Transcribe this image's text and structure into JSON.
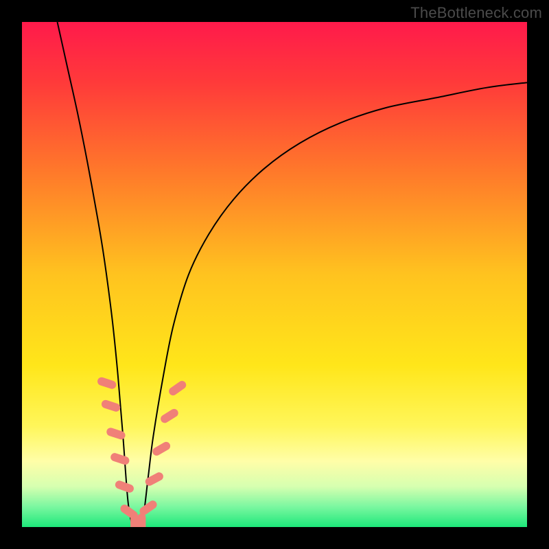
{
  "watermark": "TheBottleneck.com",
  "chart_data": {
    "type": "line",
    "title": "",
    "xlabel": "",
    "ylabel": "",
    "xlim": [
      0,
      100
    ],
    "ylim": [
      0,
      100
    ],
    "background_gradient": {
      "stops": [
        {
          "offset": 0.0,
          "color": "#ff1a4b"
        },
        {
          "offset": 0.12,
          "color": "#ff3a3a"
        },
        {
          "offset": 0.3,
          "color": "#ff7a2a"
        },
        {
          "offset": 0.5,
          "color": "#ffc31f"
        },
        {
          "offset": 0.68,
          "color": "#ffe61a"
        },
        {
          "offset": 0.8,
          "color": "#fff65a"
        },
        {
          "offset": 0.87,
          "color": "#fffea8"
        },
        {
          "offset": 0.92,
          "color": "#d6ffb0"
        },
        {
          "offset": 0.96,
          "color": "#7af7a0"
        },
        {
          "offset": 1.0,
          "color": "#1de87a"
        }
      ]
    },
    "series": [
      {
        "name": "bottleneck-curve",
        "color": "#000000",
        "stroke_width": 2,
        "x": [
          7,
          9,
          11,
          13,
          15,
          16,
          17,
          18,
          19,
          20,
          21,
          22,
          23,
          24,
          25,
          26,
          28,
          30,
          33,
          37,
          42,
          48,
          55,
          63,
          72,
          82,
          92,
          100
        ],
        "values": [
          100,
          91,
          82,
          72,
          61,
          55,
          48,
          40,
          30,
          18,
          5,
          0,
          0,
          2,
          10,
          18,
          30,
          40,
          50,
          58,
          65,
          71,
          76,
          80,
          83,
          85,
          87,
          88
        ]
      }
    ],
    "markers": {
      "name": "highlight-dashes",
      "color": "#f08078",
      "shape": "capsule",
      "points": [
        {
          "x": 16.8,
          "y": 28.5,
          "angle": -72
        },
        {
          "x": 17.6,
          "y": 24.0,
          "angle": -72
        },
        {
          "x": 18.6,
          "y": 18.5,
          "angle": -72
        },
        {
          "x": 19.4,
          "y": 13.5,
          "angle": -72
        },
        {
          "x": 20.3,
          "y": 8.0,
          "angle": -70
        },
        {
          "x": 21.2,
          "y": 3.0,
          "angle": -55
        },
        {
          "x": 22.3,
          "y": 0.8,
          "angle": 0
        },
        {
          "x": 23.7,
          "y": 0.8,
          "angle": 0
        },
        {
          "x": 25.0,
          "y": 3.8,
          "angle": 55
        },
        {
          "x": 26.2,
          "y": 9.5,
          "angle": 62
        },
        {
          "x": 27.6,
          "y": 15.5,
          "angle": 60
        },
        {
          "x": 29.2,
          "y": 22.0,
          "angle": 58
        },
        {
          "x": 30.8,
          "y": 27.5,
          "angle": 55
        }
      ]
    }
  }
}
